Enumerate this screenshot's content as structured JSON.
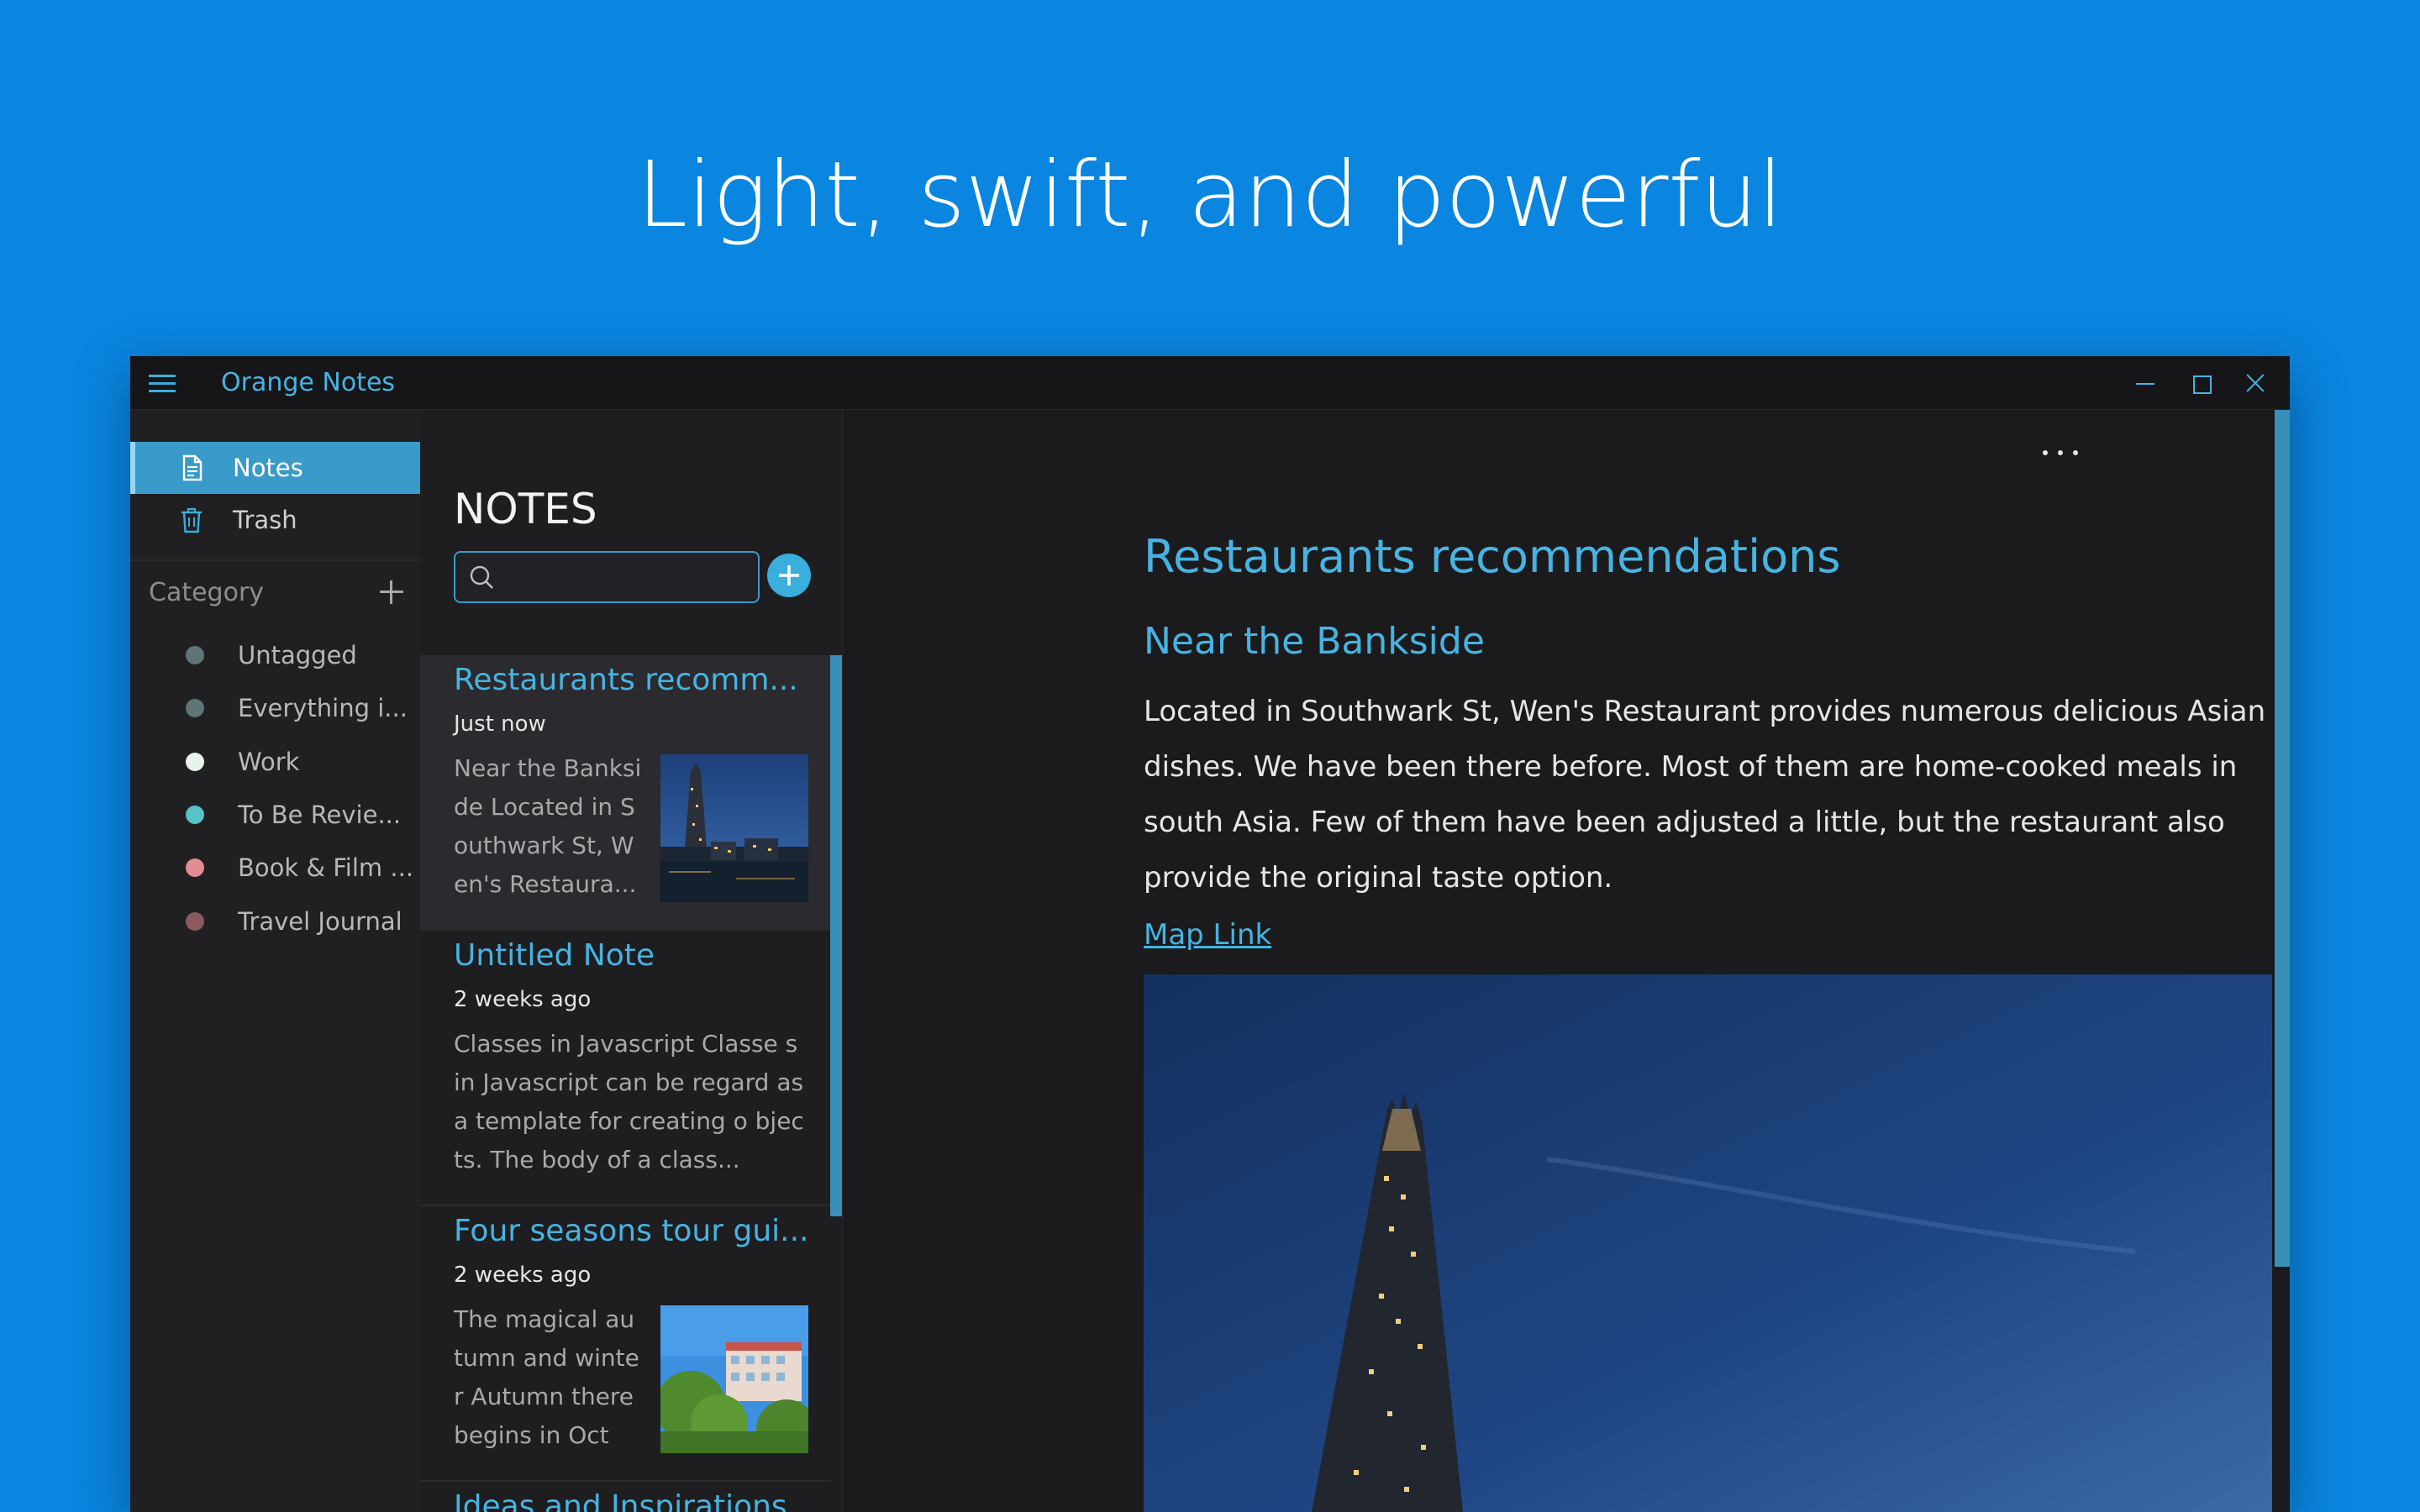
{
  "hero": {
    "headline": "Light, swift, and powerful"
  },
  "window": {
    "app_title": "Orange Notes"
  },
  "sidebar": {
    "nav": [
      {
        "label": "Notes",
        "icon": "note-document-icon",
        "active": true
      },
      {
        "label": "Trash",
        "icon": "trash-icon",
        "active": false
      }
    ],
    "category_header": "Category",
    "categories": [
      {
        "label": "Untagged",
        "color": "#5f7578"
      },
      {
        "label": "Everything i...",
        "color": "#5f7578"
      },
      {
        "label": "Work",
        "color": "#e8f3ea"
      },
      {
        "label": "To Be Revie...",
        "color": "#58c3c6"
      },
      {
        "label": "Book & Film ...",
        "color": "#e08e94"
      },
      {
        "label": "Travel Journal",
        "color": "#8a5a5e"
      }
    ]
  },
  "notes_list": {
    "heading": "NOTES",
    "search": {
      "value": "",
      "placeholder": ""
    },
    "notes": [
      {
        "title": "Restaurants recomm...",
        "time": "Just now",
        "snippet": "Near the Banksi de Located in S outhwark St, W en's Restaura...",
        "thumbnail": "night-city-skyline",
        "selected": true
      },
      {
        "title": "Untitled Note",
        "time": "2 weeks ago",
        "snippet": "Classes in Javascript Classe s in Javascript can be regard as a template for creating o bjects. The body of a class...",
        "thumbnail": null,
        "selected": false
      },
      {
        "title": "Four seasons tour gui...",
        "time": "2 weeks ago",
        "snippet": "The magical au tumn and winte r Autumn there begins in Octo...",
        "thumbnail": "autumn-building",
        "selected": false
      },
      {
        "title": "Ideas and Inspirations",
        "time": "",
        "snippet": "",
        "thumbnail": null,
        "selected": false
      }
    ]
  },
  "editor": {
    "title": "Restaurants recommendations",
    "subtitle": "Near the Bankside",
    "body": "Located in Southwark St, Wen's Restaurant provides numerous delicious Asian dishes. We have been there before. Most of them are home-cooked meals in south Asia. Few of them have been adjusted a little, but the restaurant also provide the original taste option.",
    "link_text": "Map Link",
    "image": "shard-tower-night"
  },
  "colors": {
    "background": "#0a85e0",
    "accent": "#46b4e2",
    "selection": "#3a9ac9",
    "window_bg": "#1b1a1c"
  }
}
